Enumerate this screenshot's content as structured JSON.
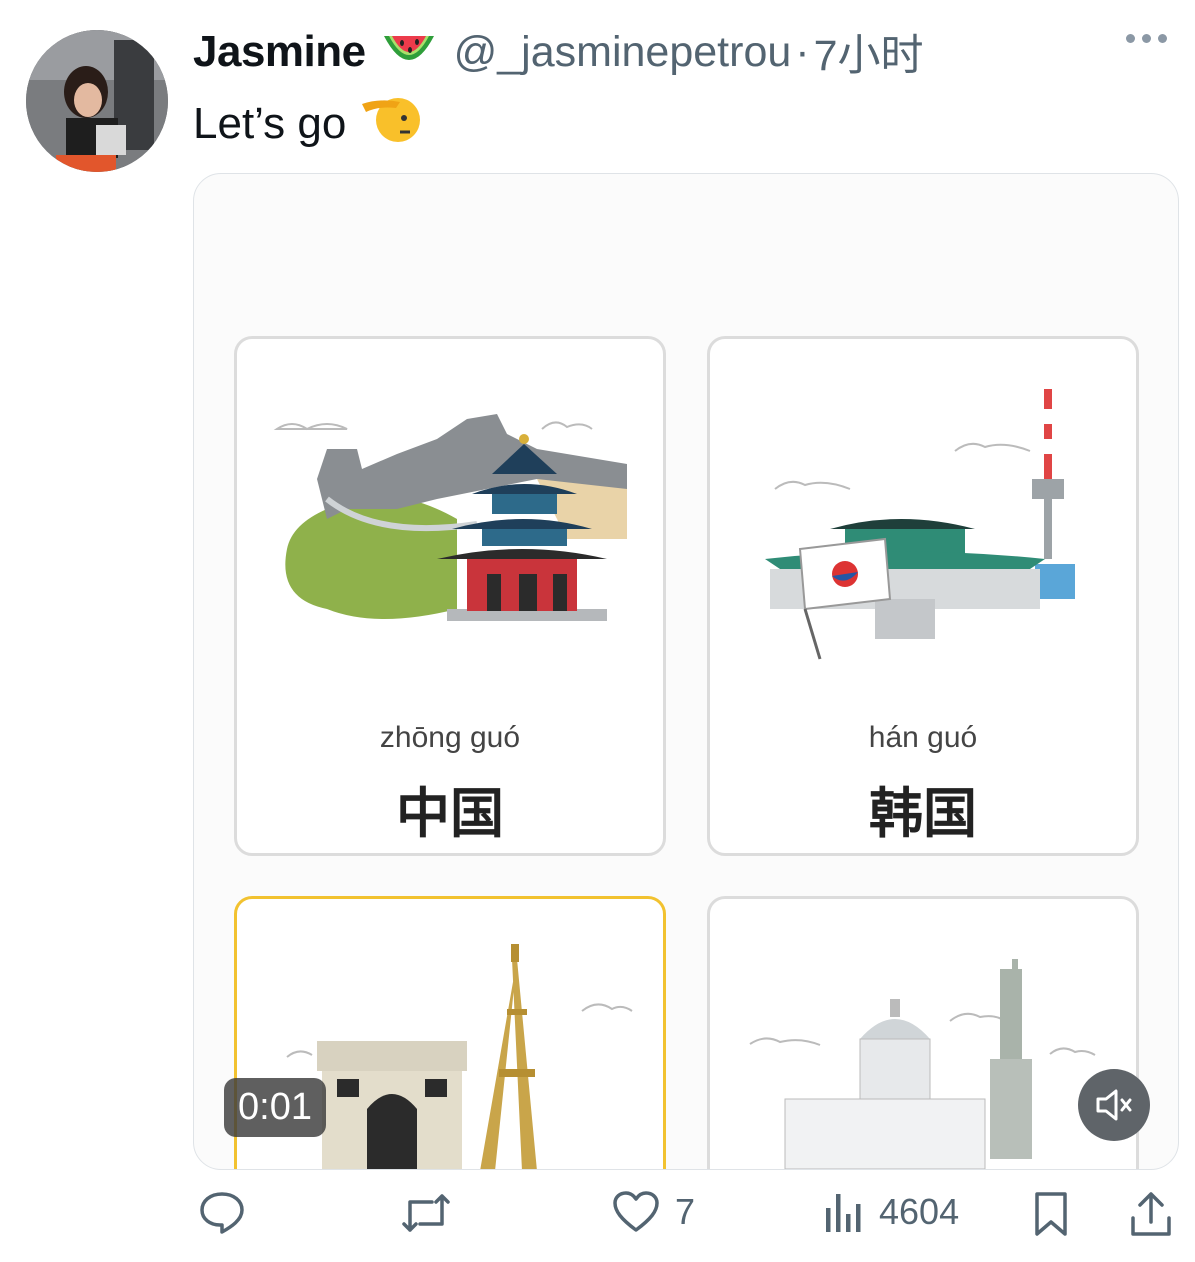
{
  "user": {
    "display_name": "Jasmine",
    "name_emoji": "watermelon-emoji",
    "handle": "@_jasminepetrou",
    "separator": "·",
    "time": "7小时"
  },
  "tweet": {
    "text": "Let’s go",
    "text_emoji": "saluting-face-emoji"
  },
  "media": {
    "cards": [
      {
        "pinyin": "zhōng guó",
        "hanzi": "中国",
        "illustration": "great-wall-temple"
      },
      {
        "pinyin": "hán guó",
        "hanzi": "韩国",
        "illustration": "korea-palace-flag-tower"
      },
      {
        "illustration": "paris-arc-eiffel",
        "highlighted": true
      },
      {
        "illustration": "usa-capitol-liberty"
      }
    ],
    "timer": "0:01",
    "mute_icon": "speaker-muted-icon"
  },
  "actions": {
    "reply_count": "",
    "retweet_count": "",
    "like_count": "7",
    "views_count": "4604"
  },
  "colors": {
    "muted_text": "#536471",
    "highlight_border": "#f2c230"
  }
}
